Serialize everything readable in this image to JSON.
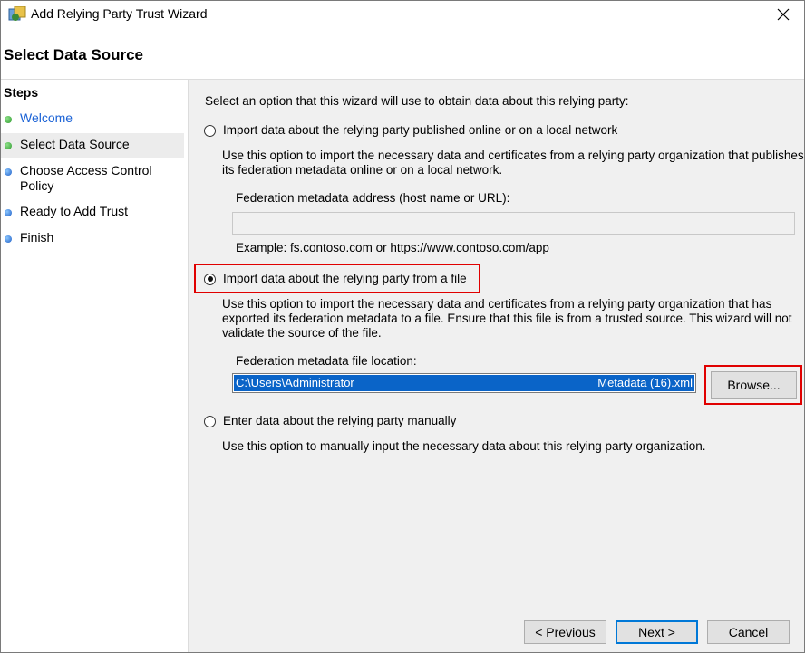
{
  "window": {
    "title": "Add Relying Party Trust Wizard"
  },
  "page_title": "Select Data Source",
  "steps": {
    "title": "Steps",
    "items": [
      {
        "label": "Welcome",
        "status": "complete",
        "color": "#2e9b2e"
      },
      {
        "label": "Select Data Source",
        "status": "current",
        "color": "#2e9b2e"
      },
      {
        "label": "Choose Access Control Policy",
        "status": "pending",
        "color": "#1f5fc6"
      },
      {
        "label": "Ready to Add Trust",
        "status": "pending",
        "color": "#1f5fc6"
      },
      {
        "label": "Finish",
        "status": "pending",
        "color": "#1f5fc6"
      }
    ]
  },
  "main": {
    "intro": "Select an option that this wizard will use to obtain data about this relying party:",
    "option_online": {
      "label": "Import data about the relying party published online or on a local network",
      "selected": false,
      "description_line1": "Use this option to import the necessary data and certificates from a relying party organization that publishes",
      "description_line2": "its federation metadata online or on a local network.",
      "field_label": "Federation metadata address (host name or URL):",
      "field_value": "",
      "example": "Example: fs.contoso.com or https://www.contoso.com/app"
    },
    "option_file": {
      "label": "Import data about the relying party from a file",
      "selected": true,
      "description_line1": "Use this option to import the necessary data and certificates from a relying party organization that has",
      "description_line2": "exported its federation metadata to a file. Ensure that this file is from a trusted source.  This wizard will not",
      "description_line3": "validate the source of the file.",
      "field_label": "Federation metadata file location:",
      "field_value_start": "C:\\Users\\Administrator",
      "field_value_end": "Metadata (16).xml",
      "browse_label": "Browse..."
    },
    "option_manual": {
      "label": "Enter data about the relying party manually",
      "selected": false,
      "description": "Use this option to manually input the necessary data about this relying party organization."
    }
  },
  "footer": {
    "previous_label": "< Previous",
    "next_label": "Next >",
    "cancel_label": "Cancel"
  },
  "colors": {
    "highlight_box": "#e00000",
    "selection": "#0a64c8",
    "link": "#1a62d6",
    "default_button_border": "#0078d7"
  }
}
